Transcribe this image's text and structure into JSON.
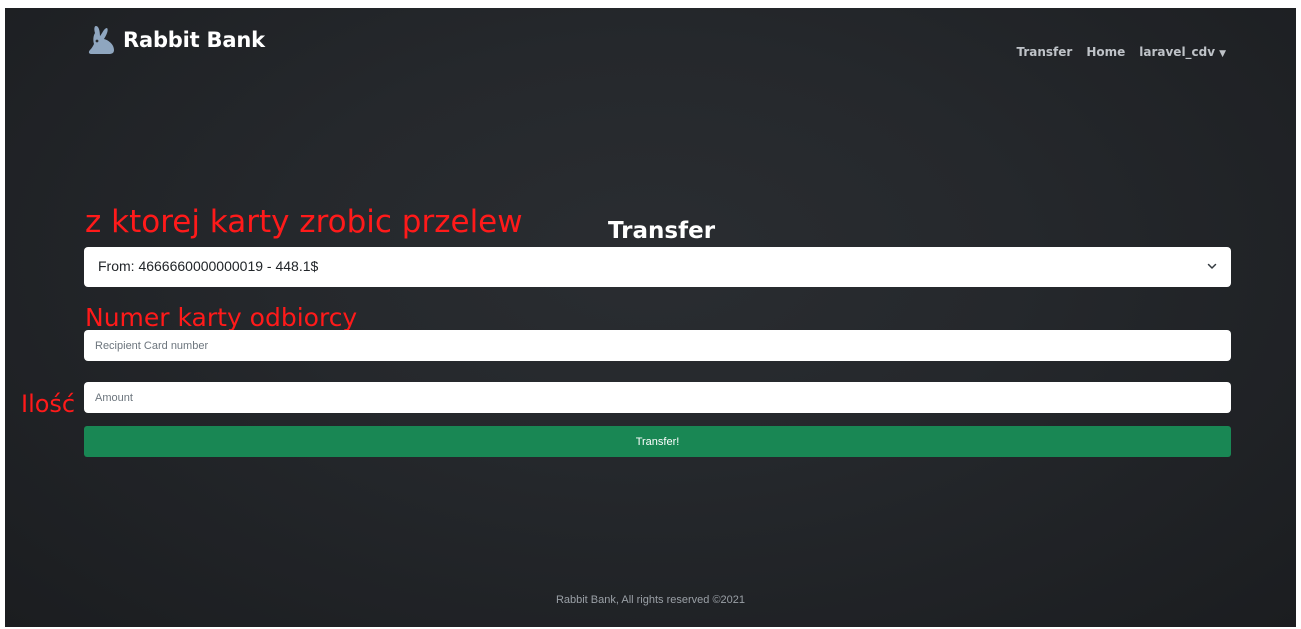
{
  "navbar": {
    "brand_logo_icon": "rabbit-icon",
    "brand_name": "Rabbit Bank",
    "links": {
      "transfer": "Transfer",
      "home": "Home",
      "user": "laravel_cdv"
    },
    "user_dropdown_icon": "caret-down-icon"
  },
  "annotations": {
    "card_source": "z ktorej karty zrobic przelew",
    "recipient": "Numer karty odbiorcy",
    "amount": "Ilość"
  },
  "form": {
    "title": "Transfer",
    "from_select": {
      "value": "From: 4666660000000019 - 448.1$",
      "icon": "chevron-down-icon"
    },
    "recipient_placeholder": "Recipient Card number",
    "amount_placeholder": "Amount",
    "submit_label": "Transfer!"
  },
  "footer": {
    "text": "Rabbit Bank, All rights reserved ©2021"
  },
  "colors": {
    "background": "#25282c",
    "submit_button": "#198754",
    "annotation": "#ff1a1a",
    "logo": "#8fa6bf"
  }
}
